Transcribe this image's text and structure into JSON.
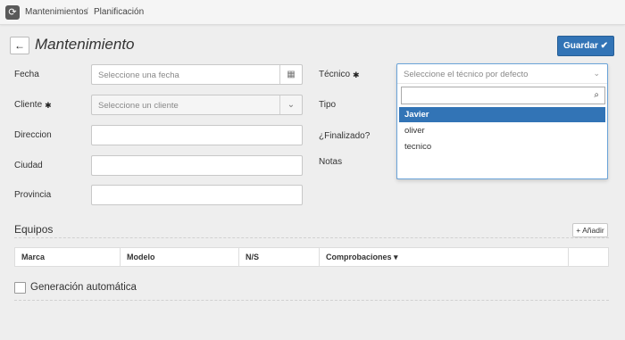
{
  "breadcrumb": {
    "home": "Mantenimientos",
    "separator": "/",
    "current": "Planificación"
  },
  "icons": {
    "logo": "refresh-icon",
    "back": "arrow-left-icon",
    "calendar": "calendar-icon",
    "gear": "gear-icon",
    "search": "search-icon",
    "check": "check-icon",
    "caret": "chevron-down-icon"
  },
  "header": {
    "back_label": "←",
    "title": "Mantenimiento",
    "save_label": "Guardar ✔"
  },
  "form": {
    "fecha": {
      "label": "Fecha",
      "placeholder": "Seleccione una fecha"
    },
    "cliente": {
      "label": "Cliente",
      "placeholder": "Seleccione un cliente"
    },
    "direccion": {
      "label": "Direccion",
      "value": ""
    },
    "ciudad": {
      "label": "Ciudad",
      "value": ""
    },
    "provincia": {
      "label": "Provincia",
      "value": ""
    },
    "tecnico": {
      "label": "Técnico",
      "placeholder": "Seleccione el técnico por defecto"
    },
    "tipo": {
      "label": "Tipo"
    },
    "finalizado": {
      "label": "¿Finalizado?"
    },
    "notas": {
      "label": "Notas"
    }
  },
  "tecnico_dropdown": {
    "search_value": "",
    "options": [
      "Javier",
      "oliver",
      "tecnico"
    ],
    "selected_index": 0
  },
  "equipos": {
    "title": "Equipos",
    "add_label": "+ Añadir",
    "columns": [
      "Marca",
      "Modelo",
      "N/S",
      "Comprobaciones ▾",
      ""
    ]
  },
  "auto": {
    "label": "Generación automática",
    "checked": false
  },
  "colors": {
    "accent": "#3274b6",
    "background": "#eeeeee"
  }
}
